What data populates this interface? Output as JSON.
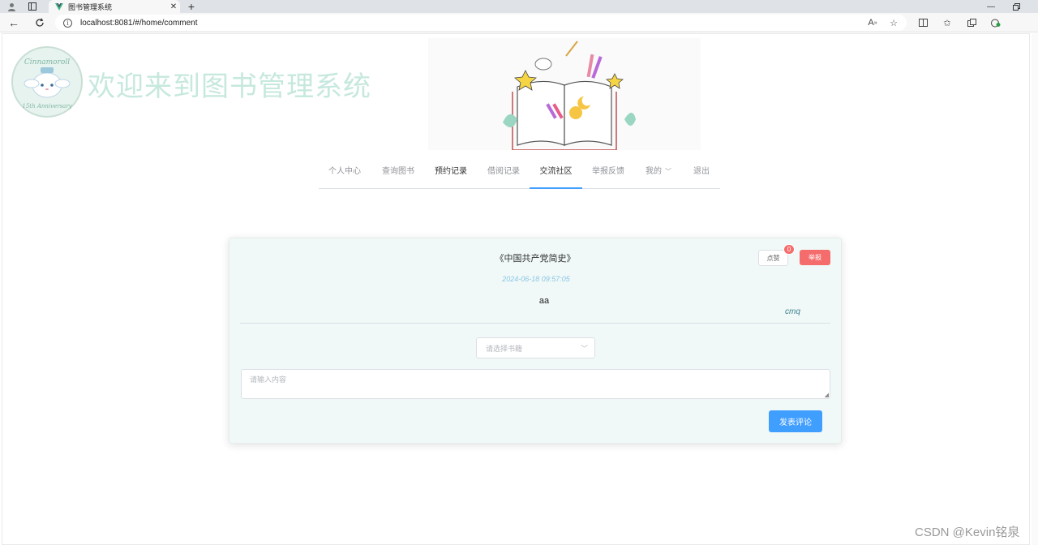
{
  "browser": {
    "tab_title": "图书管理系统",
    "url": "localhost:8081/#/home/comment"
  },
  "site": {
    "title": "欢迎来到图书管理系统",
    "logo_text_top": "Cinnamoroll",
    "logo_text_bottom": "15th Anniversary"
  },
  "menu": {
    "items": [
      {
        "label": "个人中心"
      },
      {
        "label": "查询图书"
      },
      {
        "label": "预约记录"
      },
      {
        "label": "借阅记录"
      },
      {
        "label": "交流社区"
      },
      {
        "label": "举报反馈"
      },
      {
        "label": "我的"
      },
      {
        "label": "退出"
      }
    ],
    "active_label": "交流社区"
  },
  "comment": {
    "book_title": "《中国共产党简史》",
    "like_label": "点赞",
    "like_count": "0",
    "report_label": "举报",
    "time": "2024-06-18 09:57:05",
    "content": "aa",
    "user": "cmq"
  },
  "form": {
    "select_placeholder": "请选择书籍",
    "textarea_placeholder": "请输入内容",
    "submit_label": "发表评论"
  },
  "watermark": "CSDN @Kevin铭泉",
  "colors": {
    "primary": "#409eff",
    "danger": "#f56c6c",
    "card_bg": "#f0f9f7",
    "title_color": "#c6e8df"
  }
}
